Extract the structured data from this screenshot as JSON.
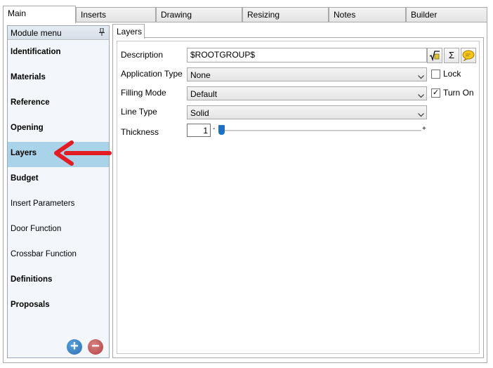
{
  "tabs": [
    {
      "label": "Main",
      "active": true
    },
    {
      "label": "Inserts",
      "active": false
    },
    {
      "label": "Drawing",
      "active": false
    },
    {
      "label": "Resizing",
      "active": false
    },
    {
      "label": "Notes",
      "active": false
    },
    {
      "label": "Builder",
      "active": false
    }
  ],
  "module_menu": {
    "title": "Module menu",
    "items": [
      {
        "label": "Identification",
        "bold": true
      },
      {
        "label": "Materials",
        "bold": true
      },
      {
        "label": "Reference",
        "bold": true
      },
      {
        "label": "Opening",
        "bold": true
      },
      {
        "label": "Layers",
        "bold": true,
        "selected": true
      },
      {
        "label": "Budget",
        "bold": true
      },
      {
        "label": "Insert Parameters",
        "bold": false
      },
      {
        "label": "Door Function",
        "bold": false
      },
      {
        "label": "Crossbar Function",
        "bold": false
      },
      {
        "label": "Definitions",
        "bold": true
      },
      {
        "label": "Proposals",
        "bold": true
      }
    ],
    "add_label": "+",
    "remove_label": "−"
  },
  "inner_tab": "Layers",
  "form": {
    "description_label": "Description",
    "description_value": "$ROOTGROUP$",
    "sigma_label": "Σ",
    "application_type_label": "Application Type",
    "application_type_value": "None",
    "lock_label": "Lock",
    "lock_checked": false,
    "filling_mode_label": "Filling Mode",
    "filling_mode_value": "Default",
    "turn_on_label": "Turn On",
    "turn_on_checked": true,
    "check_mark": "✓",
    "line_type_label": "Line Type",
    "line_type_value": "Solid",
    "thickness_label": "Thickness",
    "thickness_value": "1",
    "thickness_minus": "-",
    "thickness_plus": "+"
  },
  "colors": {
    "selected_row": "#a9d3e8",
    "slider_thumb": "#1e72c6",
    "annotation_arrow": "#e31b23"
  }
}
